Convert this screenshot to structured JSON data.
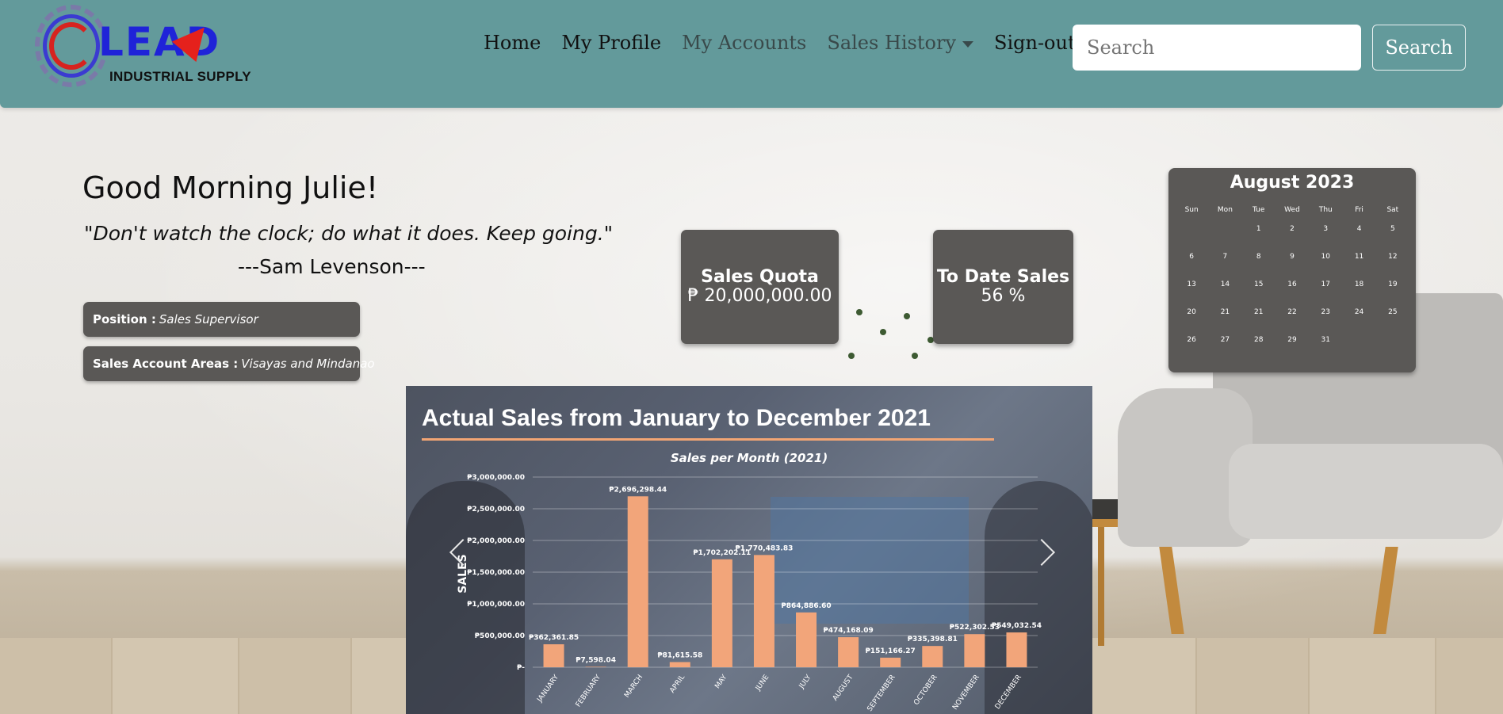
{
  "brand": {
    "logo_text": "LEAD",
    "logo_subtitle": "INDUSTRIAL SUPPLY"
  },
  "nav": {
    "items": [
      "Home",
      "My Profile",
      "My Accounts",
      "Sales History",
      "Sign-out"
    ],
    "search_placeholder": "Search",
    "search_button": "Search"
  },
  "greeting": {
    "title": "Good Morning Julie!",
    "quote": "\"Don't watch the clock; do what it does. Keep going.\"",
    "author": "---Sam Levenson---"
  },
  "info": {
    "position_label": "Position :",
    "position_value": "Sales Supervisor",
    "areas_label": "Sales Account Areas :",
    "areas_value": "Visayas and Mindanao"
  },
  "stats": {
    "quota_label": "Sales Quota",
    "quota_value": "₱ 20,000,000.00",
    "todate_label": "To Date Sales",
    "todate_value": "56 %"
  },
  "calendar": {
    "title": "August 2023",
    "days": [
      "Sun",
      "Mon",
      "Tue",
      "Wed",
      "Thu",
      "Fri",
      "Sat"
    ],
    "cells": [
      "",
      "",
      "1",
      "2",
      "3",
      "4",
      "5",
      "6",
      "7",
      "8",
      "9",
      "10",
      "11",
      "12",
      "13",
      "14",
      "15",
      "16",
      "17",
      "18",
      "19",
      "20",
      "21",
      "21",
      "22",
      "23",
      "24",
      "25",
      "26",
      "27",
      "28",
      "29",
      "31",
      "",
      ""
    ]
  },
  "chart_data": {
    "type": "bar",
    "title": "Actual Sales from January to December 2021",
    "subtitle": "Sales per Month (2021)",
    "ylabel": "SALES",
    "xlabel": "",
    "ylim": [
      0,
      3000000
    ],
    "y_ticks": [
      0,
      500000,
      1000000,
      1500000,
      2000000,
      2500000,
      3000000
    ],
    "y_tick_labels": [
      "₱-",
      "₱500,000.00",
      "₱1,000,000.00",
      "₱1,500,000.00",
      "₱2,000,000.00",
      "₱2,500,000.00",
      "₱3,000,000.00"
    ],
    "categories": [
      "JANUARY",
      "FEBRUARY",
      "MARCH",
      "APRIL",
      "MAY",
      "JUNE",
      "JULY",
      "AUGUST",
      "SEPTEMBER",
      "OCTOBER",
      "NOVEMBER",
      "DECEMBER"
    ],
    "values": [
      362361.85,
      7598.04,
      2696298.44,
      81615.58,
      1702202.11,
      1770483.83,
      864886.6,
      474168.09,
      151166.27,
      335398.81,
      522302.53,
      549032.54
    ],
    "data_labels": [
      "₱362,361.85",
      "₱7,598.04",
      "₱2,696,298.44",
      "₱81,615.58",
      "₱1,702,202.11",
      "₱1,770,483.83",
      "₱864,886.60",
      "₱474,168.09",
      "₱151,166.27",
      "₱335,398.81",
      "₱522,302.53",
      "₱549,032.54"
    ],
    "bar_color": "#f2a57a",
    "grid": true
  }
}
